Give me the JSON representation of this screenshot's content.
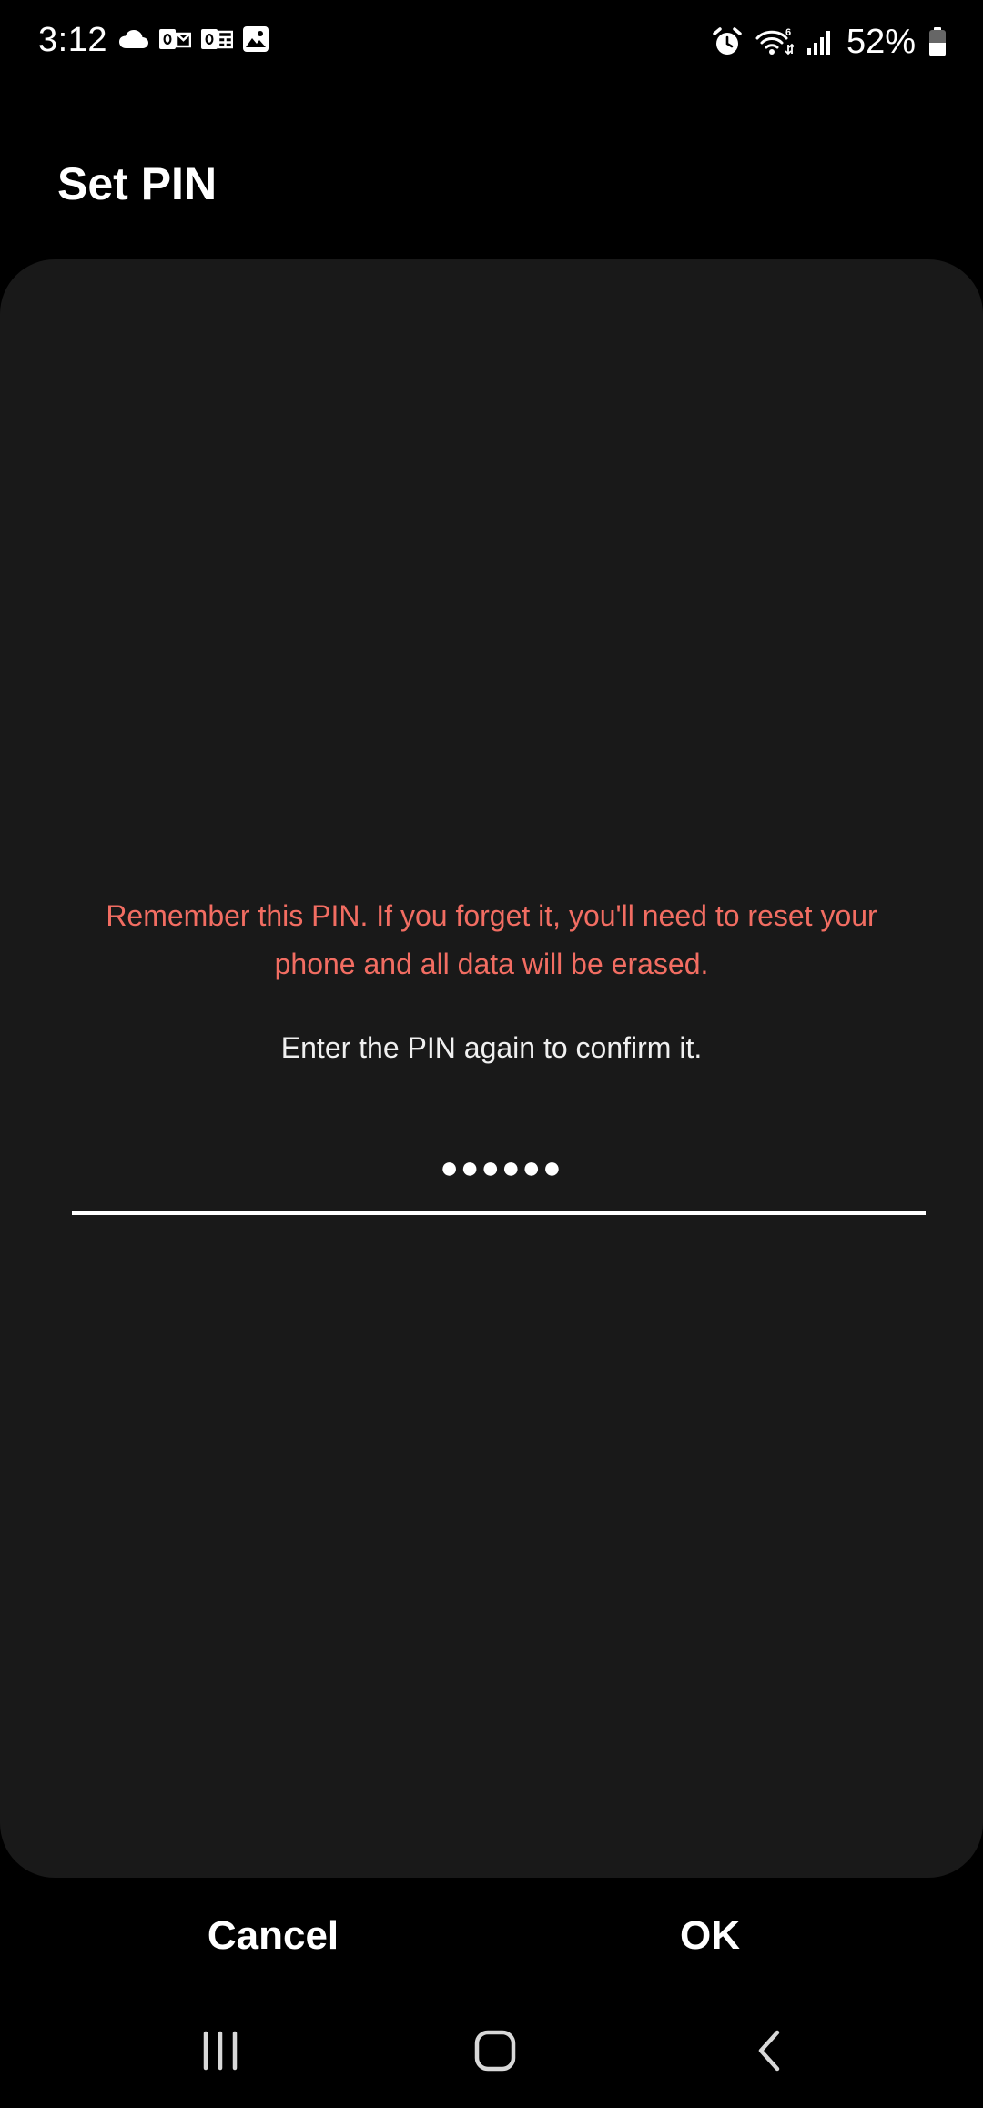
{
  "status_bar": {
    "time": "3:12",
    "left_icons": [
      "cloud-icon",
      "outlook-icon",
      "outlook-calendar-icon",
      "gallery-icon"
    ],
    "right_icons": [
      "alarm-icon",
      "wifi-icon",
      "signal-icon",
      "battery-icon"
    ],
    "battery_percent": "52%"
  },
  "header": {
    "title": "Set PIN"
  },
  "main": {
    "warning": "Remember this PIN. If you forget it, you'll need to reset your phone and all data will be erased.",
    "instruction": "Enter the PIN again to confirm it.",
    "pin_masked": "●●●●●●",
    "warning_color": "#f26d62"
  },
  "buttons": {
    "cancel_label": "Cancel",
    "ok_label": "OK"
  },
  "nav_bar": {
    "icons": [
      "recent-apps-icon",
      "home-icon",
      "back-icon"
    ]
  }
}
